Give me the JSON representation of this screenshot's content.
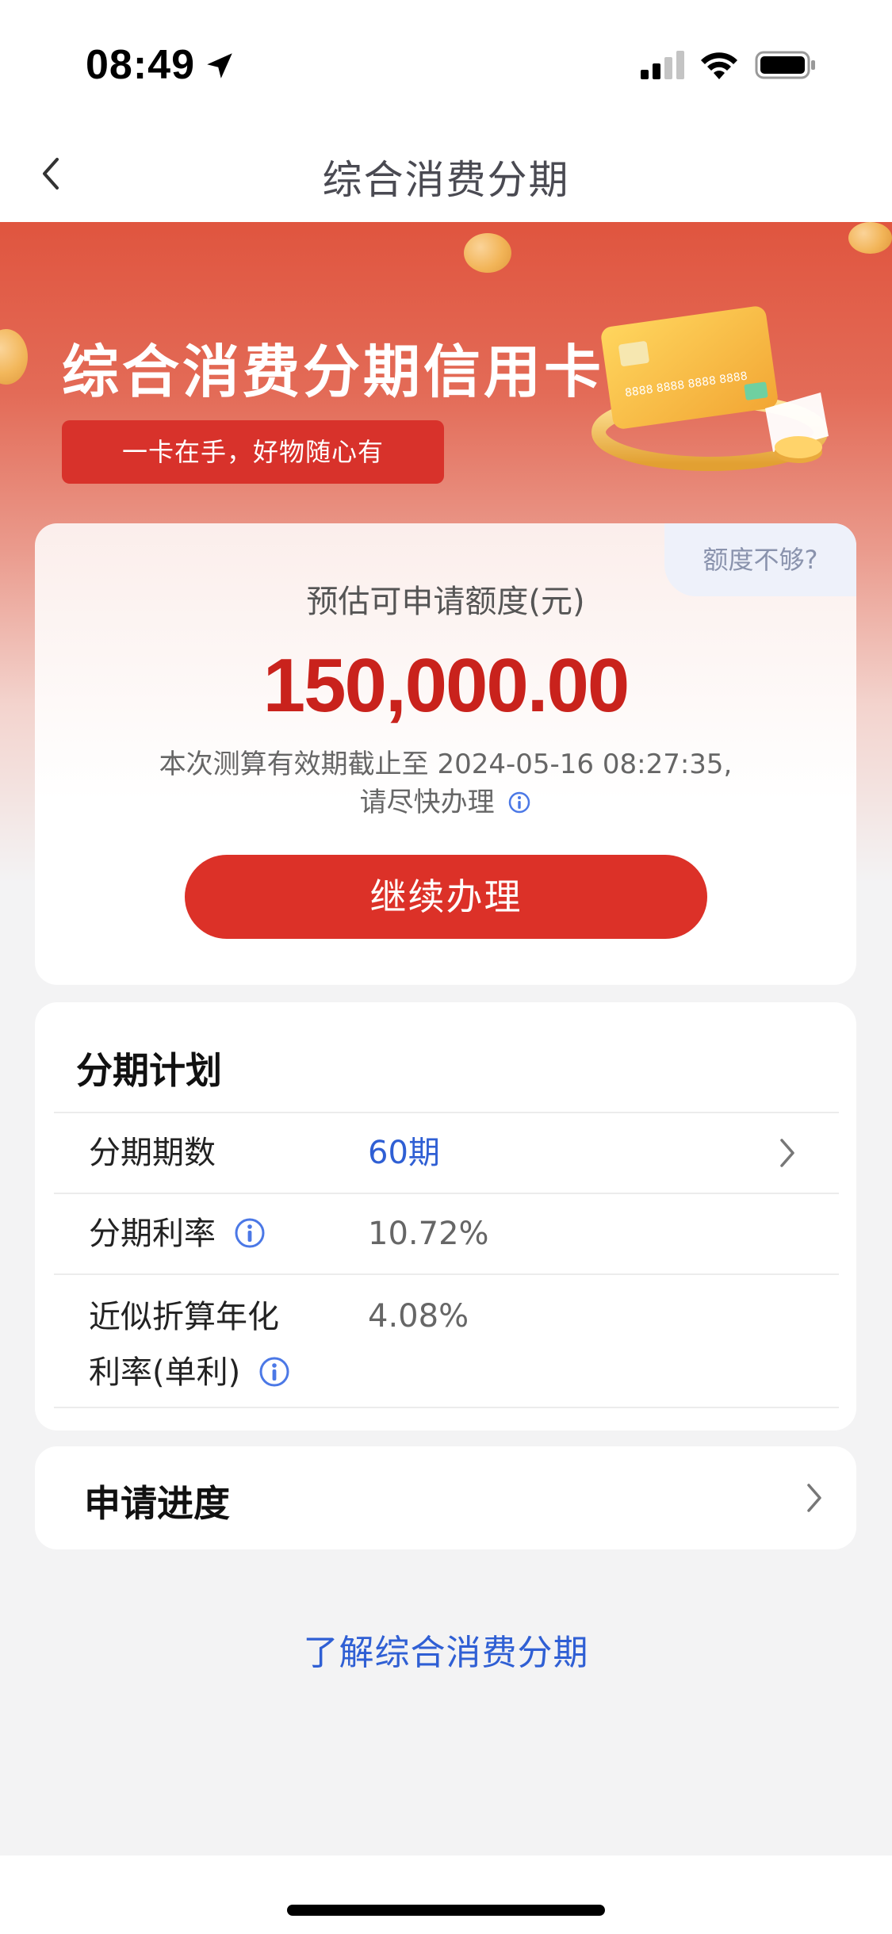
{
  "status_bar": {
    "time": "08:49",
    "icons": [
      "location-arrow-icon",
      "cellular-signal-icon",
      "wifi-icon",
      "battery-icon"
    ]
  },
  "nav": {
    "title": "综合消费分期",
    "back_icon": "chevron-left-icon"
  },
  "hero": {
    "title": "综合消费分期信用卡",
    "slogan": "一卡在手，好物随心有",
    "card_number": "8888 8888 8888 8888"
  },
  "quota": {
    "tip": "额度不够?",
    "label": "预估可申请额度(元)",
    "amount": "150,000.00",
    "valid_line1": "本次测算有效期截止至 2024-05-16 08:27:35,",
    "valid_line2": "请尽快办理",
    "continue_button": "继续办理"
  },
  "plan": {
    "title": "分期计划",
    "rows": [
      {
        "label": "分期期数",
        "value": "60期"
      },
      {
        "label": "分期利率",
        "value": "10.72%"
      },
      {
        "label_line1": "近似折算年化",
        "label_line2": "利率(单利)",
        "value": "4.08%"
      }
    ]
  },
  "progress": {
    "label": "申请进度"
  },
  "learn_more": "了解综合消费分期",
  "colors": {
    "accent_red": "#dc3128",
    "amount_red": "#c9221c",
    "link_blue": "#2f5fd4"
  }
}
